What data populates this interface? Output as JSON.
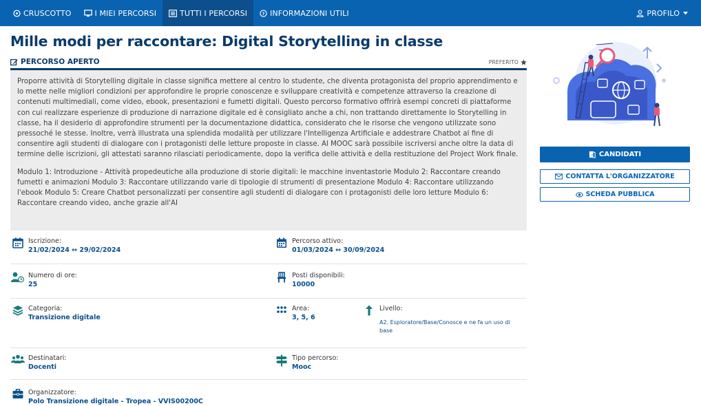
{
  "nav": {
    "items": [
      {
        "label": "CRUSCOTTO",
        "icon": "dashboard-icon"
      },
      {
        "label": "I MIEI PERCORSI",
        "icon": "monitor-icon"
      },
      {
        "label": "TUTTI I PERCORSI",
        "icon": "list-icon",
        "active": true
      },
      {
        "label": "INFORMAZIONI UTILI",
        "icon": "help-icon"
      }
    ],
    "profile": "PROFILO"
  },
  "course": {
    "title": "Mille modi per raccontare: Digital Storytelling in classe",
    "status": "PERCORSO APERTO",
    "favorite": "PREFERITO",
    "description": [
      "Proporre attività di Storytelling digitale in classe significa mettere al centro lo studente, che diventa protagonista del proprio apprendimento e lo mette nelle migliori condizioni per approfondire le proprie conoscenze e sviluppare creatività e competenze attraverso la creazione di contenuti multimediali, come video, ebook, presentazioni e fumetti digitali. Questo percorso formativo offrirà esempi concreti di piattaforme con cui realizzare esperienze di produzione di narrazione digitale ed è consigliato anche a chi, non trattando direttamente lo Storytelling in classe, ha il desiderio di approfondire strumenti per la documentazione didattica, considerato che le risorse che vengono utilizzate sono pressoché le stesse. Inoltre, verrà illustrata una splendida modalità per utilizzare l'Intelligenza Artificiale e addestrare Chatbot al fine di consentire agli studenti di dialogare con i protagonisti delle letture proposte in classe. Al MOOC sarà possibile iscriversi anche oltre la data di termine delle iscrizioni, gli attestati saranno rilasciati periodicamente, dopo la verifica delle attività e della restituzione del Project Work finale.",
      "Modulo 1: Introduzione - Attività propedeutiche alla produzione di storie digitali: le macchine inventastorie Modulo 2: Raccontare creando fumetti e animazioni Modulo 3: Raccontare utilizzando varie di tipologie di strumenti di presentazione Modulo 4: Raccontare utilizzando l'ebook Modulo 5: Creare Chatbot personalizzati per consentire agli studenti di dialogare con i protagonisti delle loro letture Modulo 6: Raccontare creando video, anche grazie all'AI"
    ]
  },
  "info": {
    "iscrizione": {
      "label": "Iscrizione:",
      "value": "21/02/2024 ↔ 29/02/2024"
    },
    "percorso_attivo": {
      "label": "Percorso attivo:",
      "value": "01/03/2024 ↔ 30/09/2024"
    },
    "ore": {
      "label": "Numero di ore:",
      "value": "25"
    },
    "posti": {
      "label": "Posti disponibili:",
      "value": "10000"
    },
    "categoria": {
      "label": "Categoria:",
      "value": "Transizione digitale"
    },
    "area": {
      "label": "Area:",
      "value": "3, 5, 6"
    },
    "livello": {
      "label": "Livello:",
      "value": "A2. Esploratore/Base/Conosce e ne fa un uso di base"
    },
    "destinatari": {
      "label": "Destinatari:",
      "value": "Docenti"
    },
    "tipo": {
      "label": "Tipo percorso:",
      "value": "Mooc"
    },
    "organizzatore": {
      "label": "Organizzatore:",
      "value": "Polo Transizione digitale - Tropea - VVIS00200C"
    }
  },
  "actions": {
    "candidati": "CANDIDATI",
    "contatta": "CONTATTA L'ORGANIZZATORE",
    "scheda": "SCHEDA PUBBLICA"
  },
  "colors": {
    "primary": "#0a63b0",
    "nav_active": "#0d4f8c",
    "title": "#0a3a6a",
    "teal_icon": "#1a7a78"
  }
}
